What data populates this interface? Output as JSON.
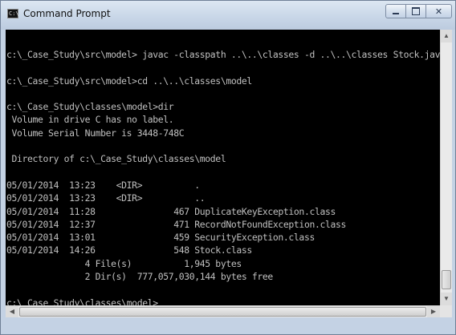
{
  "window": {
    "title": "Command Prompt",
    "app_icon_text": "C:\\",
    "minimize_label": "",
    "maximize_label": "",
    "close_label": "✕"
  },
  "console": {
    "lines": [
      "c:\\_Case_Study\\src\\model> javac -classpath ..\\..\\classes -d ..\\..\\classes Stock.java",
      "",
      "c:\\_Case_Study\\src\\model>cd ..\\..\\classes\\model",
      "",
      "c:\\_Case_Study\\classes\\model>dir",
      " Volume in drive C has no label.",
      " Volume Serial Number is 3448-748C",
      "",
      " Directory of c:\\_Case_Study\\classes\\model",
      "",
      "05/01/2014  13:23    <DIR>          .",
      "05/01/2014  13:23    <DIR>          ..",
      "05/01/2014  11:28               467 DuplicateKeyException.class",
      "05/01/2014  12:37               471 RecordNotFoundException.class",
      "05/01/2014  13:01               459 SecurityException.class",
      "05/01/2014  14:26               548 Stock.class",
      "               4 File(s)          1,945 bytes",
      "               2 Dir(s)  777,057,030,144 bytes free",
      "",
      "c:\\_Case_Study\\classes\\model>"
    ]
  },
  "colors": {
    "console_bg": "#000000",
    "console_fg": "#c0c0c0",
    "frame": "#c4d2e4"
  },
  "icons": {
    "scroll_up": "▲",
    "scroll_down": "▼",
    "scroll_left": "◀",
    "scroll_right": "▶"
  }
}
